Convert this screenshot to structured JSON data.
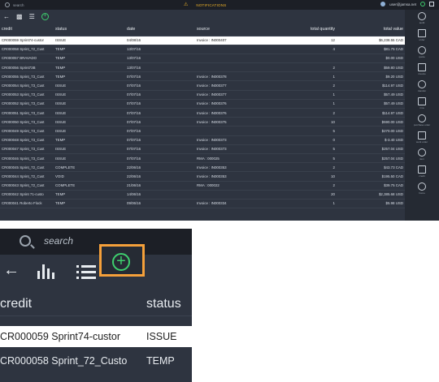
{
  "topbar": {
    "search_placeholder": "search",
    "notifications_label": "NOTIFICATIONS",
    "user_email": "user@jamsa.net"
  },
  "toolbar": {
    "back_icon": "arrow-left-icon",
    "chart_icon": "bar-chart-icon",
    "list_icon": "list-icon",
    "add_icon": "plus-circle-icon"
  },
  "table": {
    "columns": [
      "credit",
      "status",
      "date",
      "source",
      "total quantity",
      "total value"
    ],
    "rows": [
      [
        "CR000059 Sprint74-custor",
        "ISSUE",
        "04/08/16",
        "Invoice : IN000407",
        "12",
        "$6,238.55 CAD"
      ],
      [
        "CR000058 Sprint_72_Cust",
        "TEMP",
        "13/07/16",
        "",
        "4",
        "$81.75 CAD"
      ],
      [
        "CR000057 BRAVADO",
        "TEMP",
        "13/07/16",
        "",
        "",
        "$0.00 USD"
      ],
      [
        "CR000056 Sprint73B",
        "TEMP",
        "13/07/16",
        "",
        "2",
        "$59.80 USD"
      ],
      [
        "CR000055 Sprint_73_Cust",
        "TEMP",
        "07/07/16",
        "Invoice : IN000378",
        "1",
        "$9.20 USD"
      ],
      [
        "CR000054 Sprint_73_Cust",
        "ISSUE",
        "07/07/16",
        "Invoice : IN000377",
        "2",
        "$114.97 USD"
      ],
      [
        "CR000053 Sprint_73_Cust",
        "ISSUE",
        "07/07/16",
        "Invoice : IN000377",
        "1",
        "$57.49 USD"
      ],
      [
        "CR000052 Sprint_73_Cust",
        "ISSUE",
        "07/07/16",
        "Invoice : IN000376",
        "1",
        "$57.49 USD"
      ],
      [
        "CR000051 Sprint_73_Cust",
        "ISSUE",
        "07/07/16",
        "Invoice : IN000376",
        "2",
        "$114.97 USD"
      ],
      [
        "CR000050 Sprint_73_Cust",
        "ISSUE",
        "07/07/16",
        "Invoice : IN000375",
        "10",
        "$590.00 USD"
      ],
      [
        "CR000049 Sprint_73_Cust",
        "ISSUE",
        "07/07/16",
        "",
        "5",
        "$270.00 USD"
      ],
      [
        "CR000048 Sprint_73_Cust",
        "TEMP",
        "07/07/16",
        "Invoice : IN000373",
        "0",
        "$-3.40 USD"
      ],
      [
        "CR000047 Sprint_73_Cust",
        "ISSUE",
        "07/07/16",
        "Invoice : IN000373",
        "5",
        "$257.04 USD"
      ],
      [
        "CR000046 Sprint_73_Cust",
        "ISSUE",
        "07/07/16",
        "RMA : 000025",
        "5",
        "$257.04 USD"
      ],
      [
        "CR000045 Sprint_72_Cust",
        "COMPLETE",
        "22/06/16",
        "Invoice : IN000353",
        "2",
        "$43.73 CAD"
      ],
      [
        "CR000044 Sprint_72_Cust",
        "VOID",
        "22/06/16",
        "Invoice : IN000353",
        "10",
        "$195.50 CAD"
      ],
      [
        "CR000043 Sprint_72_Cust",
        "COMPLETE",
        "21/06/16",
        "RMA : 000022",
        "2",
        "$39.75 CAD"
      ],
      [
        "CR000042 Sprint 71-custo",
        "TEMP",
        "14/06/16",
        "",
        "20",
        "$2,385.68 USD"
      ],
      [
        "CR000041 Roberto Flock",
        "TEMP",
        "09/06/16",
        "Invoice : IN000334",
        "1",
        "$5.98 USD"
      ]
    ]
  },
  "sidebar": {
    "items": [
      {
        "label": "audit",
        "icon": "audit-icon"
      },
      {
        "label": "order",
        "icon": "order-icon"
      },
      {
        "label": "quote",
        "icon": "quote-icon"
      },
      {
        "label": "invoice",
        "icon": "invoice-icon"
      },
      {
        "label": "transfer",
        "icon": "transfer-icon"
      },
      {
        "label": "rma",
        "icon": "rma-icon"
      },
      {
        "label": "purchase order",
        "icon": "purchase-order-icon"
      },
      {
        "label": "work order",
        "icon": "work-order-icon"
      },
      {
        "label": "item",
        "icon": "item-icon"
      },
      {
        "label": "credit",
        "icon": "credit-icon"
      },
      {
        "label": "home",
        "icon": "home-icon"
      }
    ]
  },
  "zoom": {
    "search_placeholder": "search",
    "header_credit": "credit",
    "header_status": "status",
    "row1_credit": "CR000059 Sprint74-custor",
    "row1_status": "ISSUE",
    "row2_credit": "CR000058 Sprint_72_Custo",
    "row2_status": "TEMP",
    "highlight_color": "#f5a03a",
    "accent_green": "#3ecf6e"
  }
}
